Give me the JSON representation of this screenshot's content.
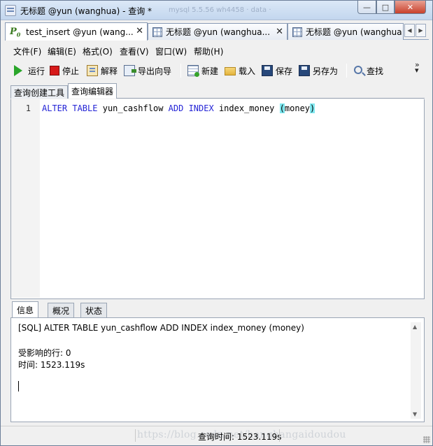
{
  "window": {
    "title": "无标题 @yun (wanghua) - 查询 *",
    "faded_bg_text": "mysql 5.5.56 wh4458 · data ·"
  },
  "doc_tabs": [
    {
      "label": "test_insert @yun (wang...",
      "icon": "p0-icon"
    },
    {
      "label": "无标题 @yun (wanghua...",
      "icon": "query-grid-icon"
    },
    {
      "label": "无标题 @yun (wanghua",
      "icon": "query-grid-icon"
    }
  ],
  "menu": [
    "文件(F)",
    "编辑(E)",
    "格式(O)",
    "查看(V)",
    "窗口(W)",
    "帮助(H)"
  ],
  "toolbar": {
    "run": "运行",
    "stop": "停止",
    "explain": "解释",
    "export_wizard": "导出向导",
    "new": "新建",
    "load": "载入",
    "save": "保存",
    "save_as": "另存为",
    "find": "查找",
    "overflow": "»"
  },
  "sub_tabs": [
    "查询创建工具",
    "查询编辑器"
  ],
  "editor": {
    "line_number": "1",
    "kw_alter": "ALTER",
    "kw_table": "TABLE",
    "table_name": "yun_cashflow",
    "kw_add": "ADD",
    "kw_index": "INDEX",
    "index_name": "index_money",
    "paren_open": "(",
    "column": "money",
    "paren_close": ")"
  },
  "info_tabs": [
    "信息",
    "概况",
    "状态"
  ],
  "info": {
    "sql_line": "[SQL] ALTER TABLE yun_cashflow ADD INDEX index_money (money)",
    "affected_rows": "受影响的行: 0",
    "time": "时间: 1523.119s"
  },
  "status": {
    "query_time": "查询时间: 1523.119s",
    "watermark": "https://blog.csdn.net/hanghangaidoudou"
  },
  "colors": {
    "keyword": "#2424d6",
    "paren_highlight": "#7fe8f0",
    "close_button": "#c9412c"
  }
}
